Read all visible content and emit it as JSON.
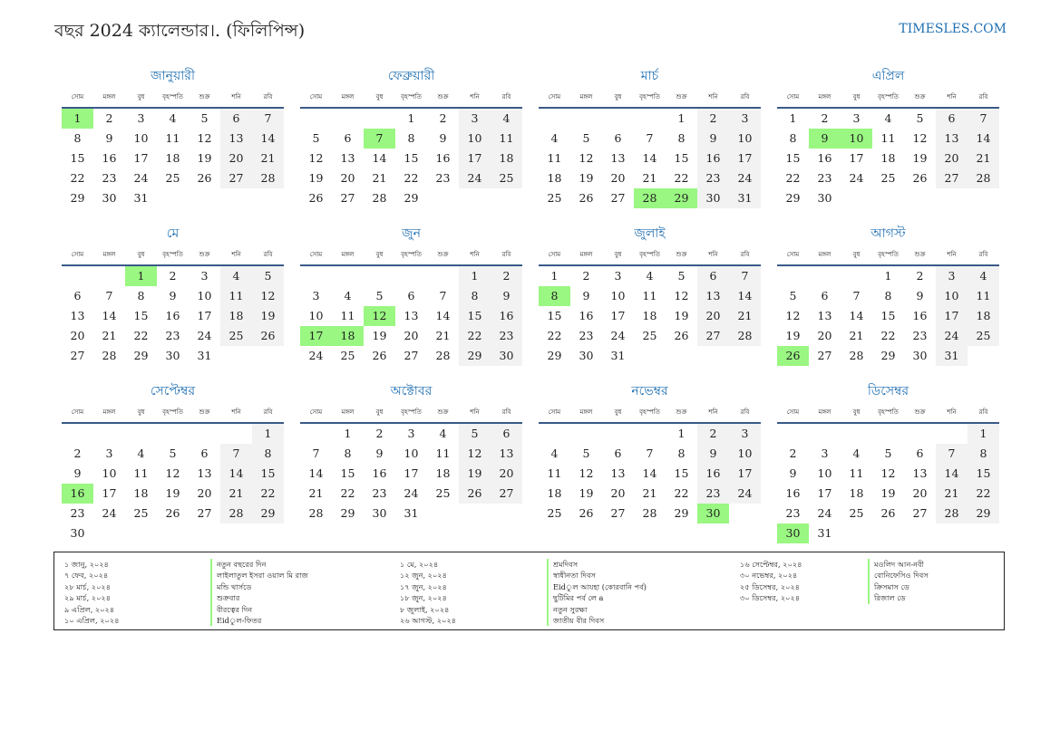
{
  "header": {
    "title": "বছর 2024 ক্যালেন্ডার।. (ফিলিপিন্স)",
    "site": "TIMESLES.COM"
  },
  "weekdays": [
    "সোম",
    "মঙ্গল",
    "বুধ",
    "বৃহস্পতি",
    "শুক্র",
    "শনি",
    "রবি"
  ],
  "months": [
    {
      "name": "জানুয়ারী",
      "start": 0,
      "days": 31,
      "holidays": [
        1
      ]
    },
    {
      "name": "ফেব্রুয়ারী",
      "start": 3,
      "days": 29,
      "holidays": [
        7
      ]
    },
    {
      "name": "মার্চ",
      "start": 4,
      "days": 31,
      "holidays": [
        28,
        29
      ]
    },
    {
      "name": "এপ্রিল",
      "start": 0,
      "days": 30,
      "holidays": [
        9,
        10
      ]
    },
    {
      "name": "মে",
      "start": 2,
      "days": 31,
      "holidays": [
        1
      ]
    },
    {
      "name": "জুন",
      "start": 5,
      "days": 30,
      "holidays": [
        12,
        17,
        18
      ]
    },
    {
      "name": "জুলাই",
      "start": 0,
      "days": 31,
      "holidays": [
        8
      ]
    },
    {
      "name": "আগস্ট",
      "start": 3,
      "days": 31,
      "holidays": [
        26
      ]
    },
    {
      "name": "সেপ্টেম্বর",
      "start": 6,
      "days": 30,
      "holidays": [
        16
      ]
    },
    {
      "name": "অক্টোবর",
      "start": 1,
      "days": 31,
      "holidays": []
    },
    {
      "name": "নভেম্বর",
      "start": 4,
      "days": 30,
      "holidays": [
        30
      ]
    },
    {
      "name": "ডিসেম্বর",
      "start": 6,
      "days": 31,
      "holidays": [
        30
      ]
    }
  ],
  "legend": [
    {
      "dates": [
        "১ জানু, ২০২৪",
        "৭ ফেব, ২০২৪",
        "২৮ মার্চ, ২০২৪",
        "২৯ মার্চ, ২০২৪",
        "৯ এপ্রিল, ২০২৪",
        "১০ এপ্রিল, ২০২৪"
      ],
      "names": [
        "নতুন বছরের দিন",
        "লাইলাতুল ইসরা ওয়াল মি রাজ",
        "মন্ডি থার্সডে",
        "শুক্রবার",
        "বীরত্বের দিন",
        "Eidুল-ফিতর"
      ]
    },
    {
      "dates": [
        "১ মে, ২০২৪",
        "১২ জুন, ২০২৪",
        "১৭ জুন, ২০২৪",
        "১৮ জুন, ২০২৪",
        "৮ জুলাই, ২০২৪",
        "২৬ আগস্ট, ২০২৪"
      ],
      "names": [
        "শ্রমদিবস",
        "স্বাধীনতা দিবস",
        "Eidুল আযহা (কোরবানি পর্ব)",
        "ছুটিমির পর্ব লে a",
        "নতুন সুরক্ষা",
        "জাতীয় বীর দিবস"
      ]
    },
    {
      "dates": [
        "১৬ সেপ্টেম্বর, ২০২৪",
        "৩০ নভেম্বর, ২০২৪",
        "২৫ ডিসেম্বর, ২০২৪",
        "৩০ ডিসেম্বর, ২০২৪"
      ],
      "names": [
        "মওলিদ আন-নবী",
        "বোনিফেসিও দিবস",
        "ক্রিসমাস ডে",
        "রিজাল ডে"
      ]
    }
  ],
  "colors": {
    "holiday": "#9af782",
    "weekend": "#f2f2f2",
    "accent": "#1f6fb2",
    "rule": "#3a5a88"
  }
}
